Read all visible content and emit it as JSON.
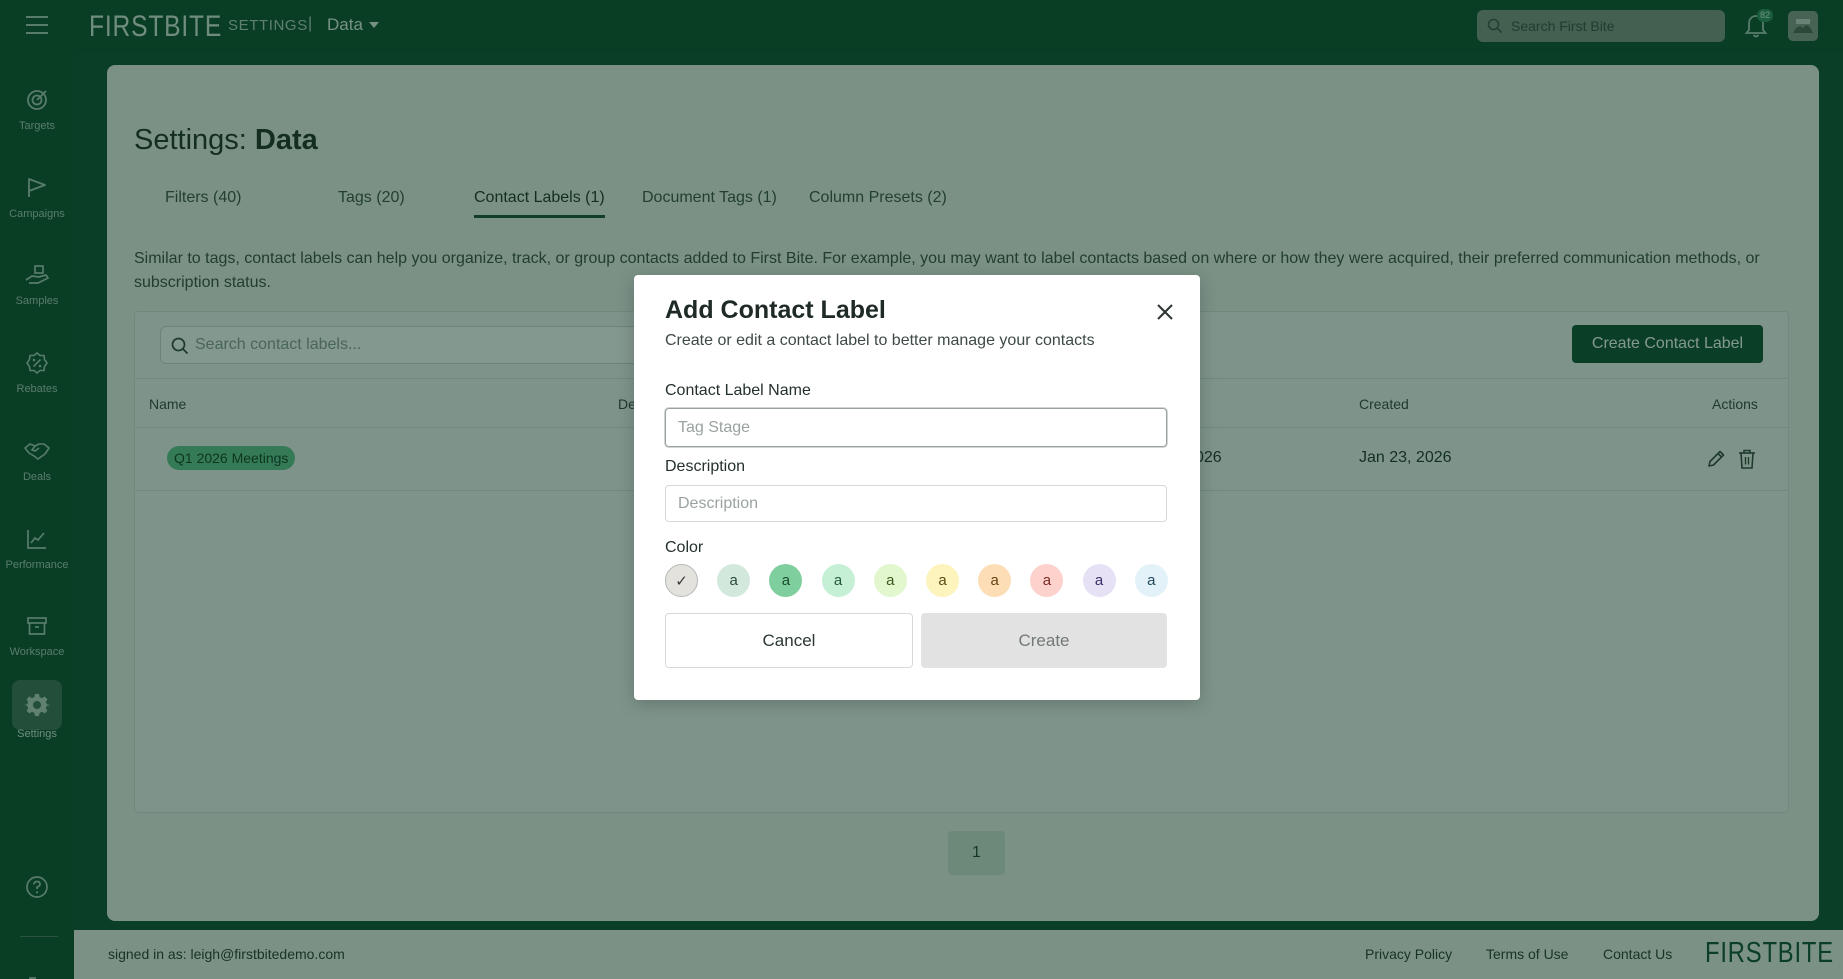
{
  "topbar": {
    "logo": "FIRSTBITE",
    "breadcrumb_section": "SETTINGS",
    "breadcrumb_separator": "|",
    "breadcrumb_current": "Data",
    "search_placeholder": "Search First Bite",
    "notification_count": "82"
  },
  "sidebar": {
    "items": [
      {
        "label": "Targets",
        "icon": "target-icon"
      },
      {
        "label": "Campaigns",
        "icon": "flag-icon"
      },
      {
        "label": "Samples",
        "icon": "hand-box-icon"
      },
      {
        "label": "Rebates",
        "icon": "percent-badge-icon"
      },
      {
        "label": "Deals",
        "icon": "handshake-icon"
      },
      {
        "label": "Performance",
        "icon": "chart-line-icon"
      },
      {
        "label": "Workspace",
        "icon": "box-icon"
      },
      {
        "label": "Settings",
        "icon": "gear-icon",
        "active": true
      }
    ]
  },
  "page": {
    "title_prefix": "Settings:",
    "title_strong": "Data",
    "tabs": [
      {
        "label": "Filters (40)"
      },
      {
        "label": "Tags (20)"
      },
      {
        "label": "Contact Labels (1)",
        "active": true
      },
      {
        "label": "Document Tags (1)"
      },
      {
        "label": "Column Presets (2)"
      }
    ],
    "description": "Similar to tags, contact labels can help you organize, track, or group contacts added to First Bite. For example, you may want to label contacts based on where or how they were acquired, their preferred communication methods, or subscription status.",
    "search_placeholder": "Search contact labels...",
    "create_button": "Create Contact Label",
    "table": {
      "columns": [
        "Name",
        "De",
        "Created",
        "Actions"
      ],
      "rows": [
        {
          "name": "Q1 2026 Meetings",
          "updated": "026",
          "created": "Jan 23, 2026"
        }
      ]
    },
    "pagination": {
      "current": "1"
    }
  },
  "footer": {
    "signed_in_prefix": "signed in as:",
    "email": "leigh@firstbitedemo.com",
    "links": [
      "Privacy Policy",
      "Terms of Use",
      "Contact Us"
    ],
    "logo": "FIRSTBITE"
  },
  "modal": {
    "title": "Add Contact Label",
    "subtitle": "Create or edit a contact label to better manage your contacts",
    "name_label": "Contact Label Name",
    "name_placeholder": "Tag Stage",
    "description_label": "Description",
    "description_placeholder": "Description",
    "color_label": "Color",
    "colors": [
      {
        "glyph": "✓",
        "bg": "#e3e2dc",
        "fg": "#3a3a3a",
        "selected": true
      },
      {
        "glyph": "a",
        "bg": "#d3e8dc",
        "fg": "#2b4a3a"
      },
      {
        "glyph": "a",
        "bg": "#7fcf9e",
        "fg": "#1b4a2e"
      },
      {
        "glyph": "a",
        "bg": "#c5f0d6",
        "fg": "#235a3b"
      },
      {
        "glyph": "a",
        "bg": "#e2f7cd",
        "fg": "#3e5a22"
      },
      {
        "glyph": "a",
        "bg": "#fdf3bd",
        "fg": "#5d4f12"
      },
      {
        "glyph": "a",
        "bg": "#fcddb5",
        "fg": "#6a4314"
      },
      {
        "glyph": "a",
        "bg": "#fdd2cc",
        "fg": "#7a2a22"
      },
      {
        "glyph": "a",
        "bg": "#e6e1f4",
        "fg": "#3d2f6a"
      },
      {
        "glyph": "a",
        "bg": "#e3f1f8",
        "fg": "#234a5c"
      }
    ],
    "cancel_button": "Cancel",
    "create_button": "Create"
  }
}
